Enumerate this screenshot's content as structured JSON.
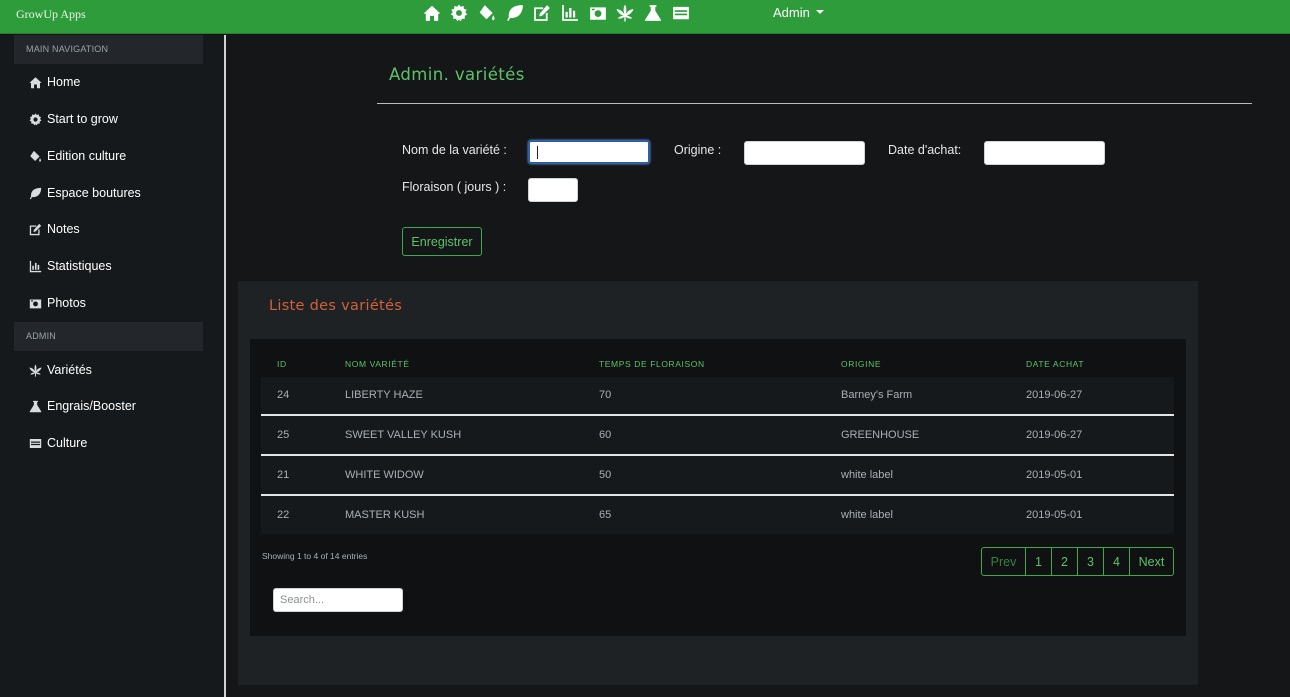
{
  "app": {
    "brand": "GrowUp Apps"
  },
  "topnav": {
    "icons": [
      "home-icon",
      "gear-icon",
      "paint-bucket-icon",
      "leaf-icon",
      "edit-icon",
      "chart-icon",
      "camera-icon",
      "cannabis-leaf-icon",
      "flask-icon",
      "card-icon"
    ],
    "admin_label": "Admin"
  },
  "sidebar": {
    "section_main": "MAIN NAVIGATION",
    "section_admin": "ADMIN",
    "main_items": [
      {
        "label": "Home",
        "icon": "home-icon"
      },
      {
        "label": "Start to grow",
        "icon": "gear-icon"
      },
      {
        "label": "Edition culture",
        "icon": "paint-bucket-icon"
      },
      {
        "label": "Espace boutures",
        "icon": "leaf-icon"
      },
      {
        "label": "Notes",
        "icon": "edit-icon"
      },
      {
        "label": "Statistiques",
        "icon": "chart-icon"
      },
      {
        "label": "Photos",
        "icon": "camera-icon"
      }
    ],
    "admin_items": [
      {
        "label": "Variétés",
        "icon": "cannabis-leaf-icon"
      },
      {
        "label": "Engrais/Booster",
        "icon": "flask-icon"
      },
      {
        "label": "Culture",
        "icon": "card-icon"
      }
    ]
  },
  "page": {
    "title": "Admin. variétés"
  },
  "form": {
    "name_label": "Nom de la variété :",
    "name_value": "",
    "origin_label": "Origine :",
    "origin_value": "",
    "date_label": "Date d'achat:",
    "date_value": "",
    "flowering_label": "Floraison ( jours ) :",
    "flowering_value": "",
    "save_label": "Enregistrer"
  },
  "list": {
    "title": "Liste des variétés",
    "columns": [
      "ID",
      "NOM VARIÉTÉ",
      "TEMPS DE FLORAISON",
      "ORIGINE",
      "DATE ACHAT"
    ],
    "rows": [
      {
        "id": "24",
        "name": "LIBERTY HAZE",
        "flowering": "70",
        "origin": "Barney's Farm",
        "date": "2019-06-27"
      },
      {
        "id": "25",
        "name": "SWEET VALLEY KUSH",
        "flowering": "60",
        "origin": "GREENHOUSE",
        "date": "2019-06-27"
      },
      {
        "id": "21",
        "name": "WHITE WIDOW",
        "flowering": "50",
        "origin": "white label",
        "date": "2019-05-01"
      },
      {
        "id": "22",
        "name": "MASTER KUSH",
        "flowering": "65",
        "origin": "white label",
        "date": "2019-05-01"
      }
    ],
    "info": "Showing 1 to 4 of 14 entries",
    "pagination": {
      "prev": "Prev",
      "pages": [
        "1",
        "2",
        "3",
        "4"
      ],
      "next": "Next"
    },
    "search_placeholder": "Search..."
  },
  "colors": {
    "navbar": "#2e9c3b",
    "accent_green": "#5ec26a",
    "accent_orange": "#d2603a",
    "background": "#141618"
  }
}
